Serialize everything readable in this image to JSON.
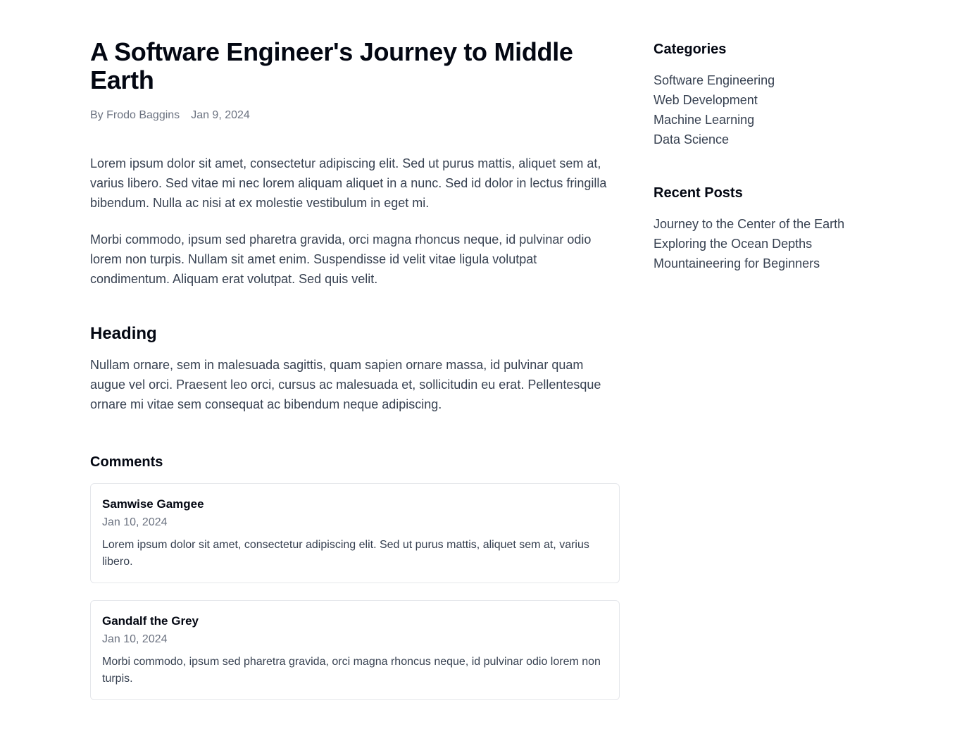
{
  "post": {
    "title": "A Software Engineer's Journey to Middle Earth",
    "author": "By Frodo Baggins",
    "date": "Jan 9, 2024",
    "paragraphs": [
      "Lorem ipsum dolor sit amet, consectetur adipiscing elit. Sed ut purus mattis, aliquet sem at, varius libero. Sed vitae mi nec lorem aliquam aliquet in a nunc. Sed id dolor in lectus fringilla bibendum. Nulla ac nisi at ex molestie vestibulum in eget mi.",
      "Morbi commodo, ipsum sed pharetra gravida, orci magna rhoncus neque, id pulvinar odio lorem non turpis. Nullam sit amet enim. Suspendisse id velit vitae ligula volutpat condimentum. Aliquam erat volutpat. Sed quis velit."
    ],
    "section_heading": "Heading",
    "section_paragraph": "Nullam ornare, sem in malesuada sagittis, quam sapien ornare massa, id pulvinar quam augue vel orci. Praesent leo orci, cursus ac malesuada et, sollicitudin eu erat. Pellentesque ornare mi vitae sem consequat ac bibendum neque adipiscing."
  },
  "comments": {
    "title": "Comments",
    "items": [
      {
        "author": "Samwise Gamgee",
        "date": "Jan 10, 2024",
        "text": "Lorem ipsum dolor sit amet, consectetur adipiscing elit. Sed ut purus mattis, aliquet sem at, varius libero."
      },
      {
        "author": "Gandalf the Grey",
        "date": "Jan 10, 2024",
        "text": "Morbi commodo, ipsum sed pharetra gravida, orci magna rhoncus neque, id pulvinar odio lorem non turpis."
      }
    ]
  },
  "sidebar": {
    "categories": {
      "title": "Categories",
      "items": [
        "Software Engineering",
        "Web Development",
        "Machine Learning",
        "Data Science"
      ]
    },
    "recent_posts": {
      "title": "Recent Posts",
      "items": [
        "Journey to the Center of the Earth",
        "Exploring the Ocean Depths",
        "Mountaineering for Beginners"
      ]
    }
  },
  "colors": {
    "heading": "#030712",
    "body": "#374151",
    "muted": "#6b7280",
    "border": "#e5e7eb",
    "background": "#ffffff"
  }
}
